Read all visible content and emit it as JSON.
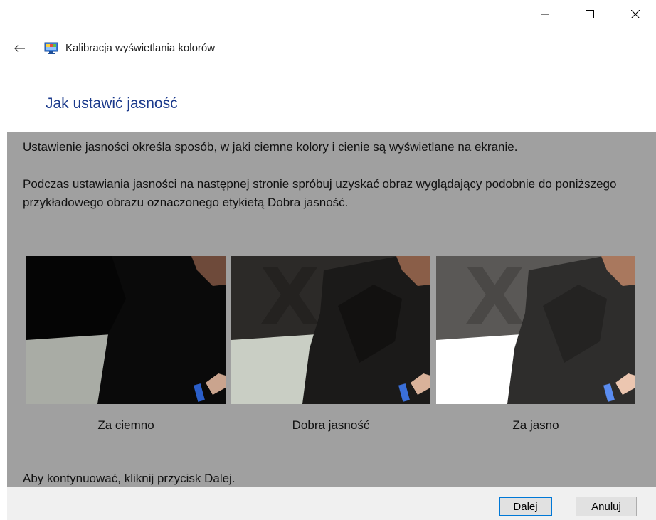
{
  "window": {
    "title": "Kalibracja wyświetlania kolorów",
    "controls": [
      "minimize-icon",
      "maximize-icon",
      "close-icon"
    ]
  },
  "page": {
    "heading": "Jak ustawić jasność",
    "paragraph1": "Ustawienie jasności określa sposób, w jaki ciemne kolory i cienie są wyświetlane na ekranie.",
    "paragraph2": "Podczas ustawiania jasności na następnej stronie spróbuj uzyskać obraz wyglądający podobnie do poniższego przykładowego obrazu oznaczonego etykietą Dobra jasność.",
    "examples": [
      {
        "caption": "Za ciemno"
      },
      {
        "caption": "Dobra jasność"
      },
      {
        "caption": "Za jasno"
      }
    ],
    "instruction": "Aby kontynuować, kliknij przycisk Dalej."
  },
  "buttons": {
    "next_accel": "D",
    "next_rest": "alej",
    "cancel": "Anuluj"
  },
  "colors": {
    "heading": "#1b3a8c",
    "content_bg": "#a0a0a0",
    "footer_bg": "#f0f0f0",
    "default_button_border": "#0078d7"
  }
}
